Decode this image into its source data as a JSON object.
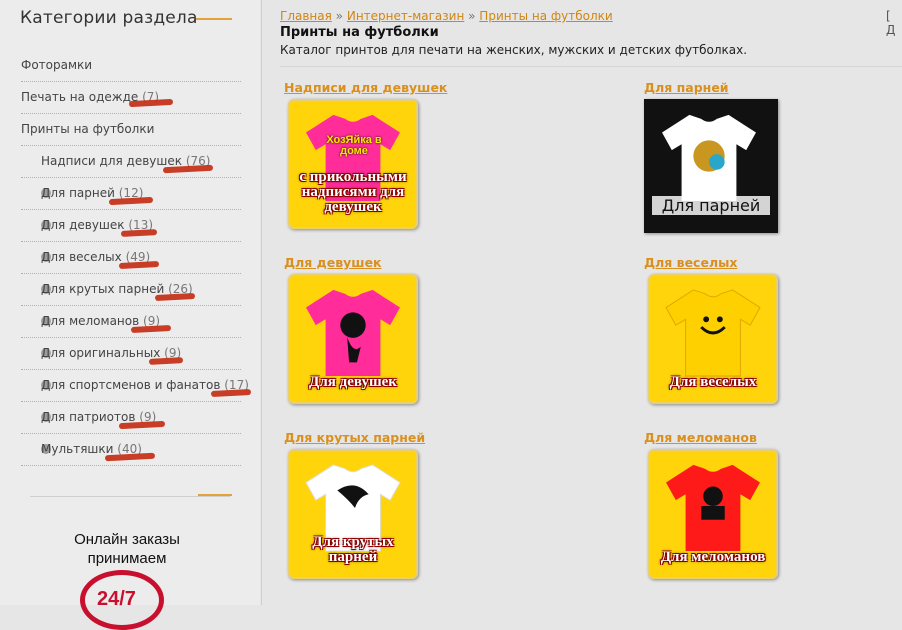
{
  "sidebar": {
    "title": "Категории раздела",
    "items": [
      {
        "label": "Фоторамки",
        "count": ""
      },
      {
        "label": "Печать на одежде",
        "count": "(7)"
      },
      {
        "label": "Принты на футболки",
        "count": ""
      }
    ],
    "subitems": [
      {
        "label": "Надписи для девушек",
        "count": "(76)"
      },
      {
        "label": "Для парней",
        "count": "(12)"
      },
      {
        "label": "Для девушек",
        "count": "(13)"
      },
      {
        "label": "Для веселых",
        "count": "(49)"
      },
      {
        "label": "Для крутых парней",
        "count": "(26)"
      },
      {
        "label": "Для меломанов",
        "count": "(9)"
      },
      {
        "label": "Для оригинальных",
        "count": "(9)"
      },
      {
        "label": "Для спортсменов и фанатов",
        "count": "(17)"
      },
      {
        "label": "Для патриотов",
        "count": "(9)"
      },
      {
        "label": "Мультяшки",
        "count": "(40)"
      }
    ],
    "online_text": "Онлайн заказы принимаем",
    "clock_text": "24/7"
  },
  "breadcrumb": {
    "home": "Главная",
    "shop": "Интернет-магазин",
    "current": "Принты на футболки",
    "separator": "»"
  },
  "corner_text": "[ Д",
  "page": {
    "title": "Принты на футболки",
    "description": "Каталог принтов для печати на женских, мужских и детских футболках."
  },
  "categories": [
    {
      "title": "Надписи для девушек",
      "shirt_text": "ХозЯйка в доме",
      "overlay": "с прикольными надписями для девушек",
      "shirt_color": "#ff2c9a",
      "bg": "#ffd40a"
    },
    {
      "title": "Для парней",
      "overlay": "Для парней",
      "shirt_color": "#ffffff",
      "bg": "#111111"
    },
    {
      "title": "Для девушек",
      "overlay": "Для девушек",
      "shirt_color": "#ff2c9a",
      "bg": "#ffd40a"
    },
    {
      "title": "Для веселых",
      "overlay": "Для веселых",
      "shirt_color": "#ffd000",
      "bg": "#ffd40a"
    },
    {
      "title": "Для крутых парней",
      "overlay": "Для крутых парней",
      "shirt_color": "#ffffff",
      "bg": "#ffd40a"
    },
    {
      "title": "Для меломанов",
      "overlay": "Для меломанов",
      "shirt_color": "#ff1a1a",
      "bg": "#ffd40a"
    }
  ],
  "colors": {
    "accent": "#e2a43a",
    "link": "#d08514",
    "marker": "#c42a10"
  }
}
